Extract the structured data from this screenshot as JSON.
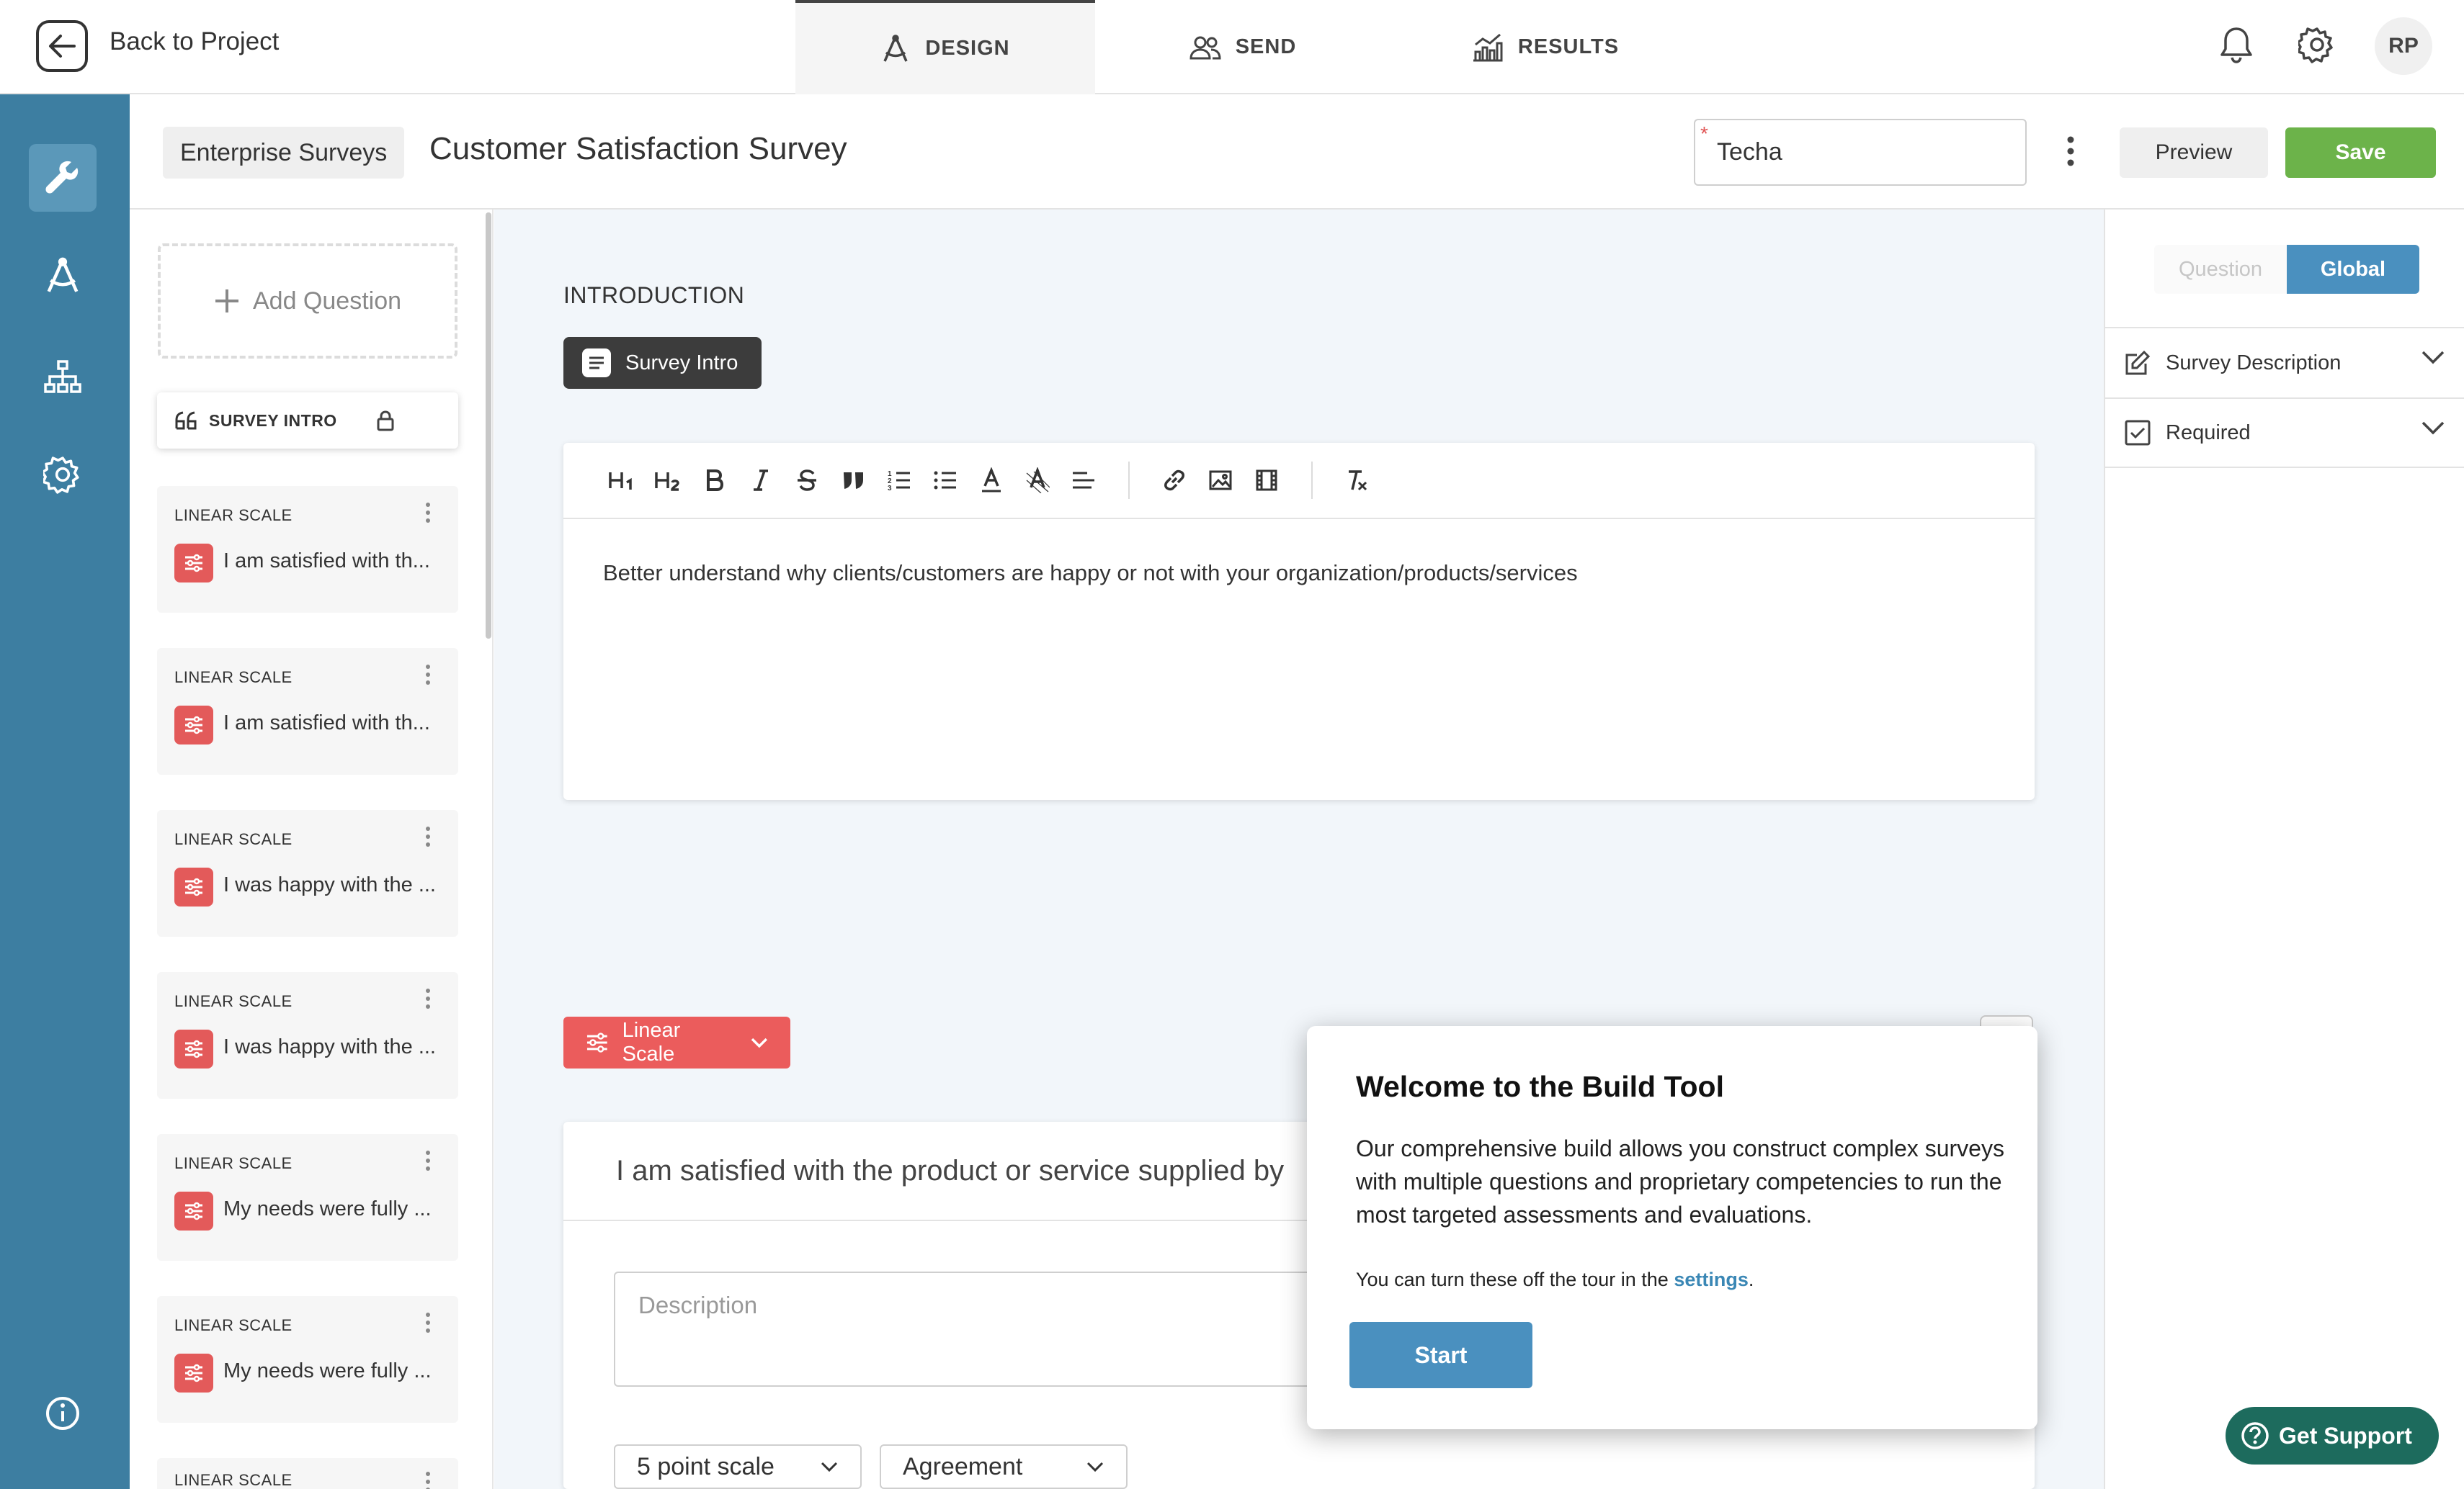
{
  "topbar": {
    "back_label": "Back to Project",
    "tabs": [
      {
        "label": "DESIGN",
        "icon": "compass-icon",
        "active": true
      },
      {
        "label": "SEND",
        "icon": "users-icon",
        "active": false
      },
      {
        "label": "RESULTS",
        "icon": "chart-icon",
        "active": false
      }
    ],
    "avatar_initials": "RP"
  },
  "header": {
    "breadcrumb": "Enterprise Surveys",
    "title": "Customer Satisfaction Survey",
    "tenant_value": "Techa",
    "required_marker": "*",
    "preview_label": "Preview",
    "save_label": "Save"
  },
  "sidebar": {
    "add_question_label": "Add Question",
    "intro_label": "SURVEY INTRO",
    "questions": [
      {
        "type": "LINEAR SCALE",
        "text": "I am satisfied with th..."
      },
      {
        "type": "LINEAR SCALE",
        "text": "I am satisfied with th..."
      },
      {
        "type": "LINEAR SCALE",
        "text": "I was happy with the ..."
      },
      {
        "type": "LINEAR SCALE",
        "text": "I was happy with the ..."
      },
      {
        "type": "LINEAR SCALE",
        "text": "My needs were fully ..."
      },
      {
        "type": "LINEAR SCALE",
        "text": "My needs were fully ..."
      },
      {
        "type": "LINEAR SCALE",
        "text": ""
      }
    ]
  },
  "main": {
    "section_heading": "INTRODUCTION",
    "intro_pill": "Survey Intro",
    "editor_text": "Better understand why clients/customers are happy or not with your organization/products/services",
    "question_type_pill": "Linear Scale",
    "question_text": "I am satisfied with the product or service supplied by",
    "description_placeholder": "Description",
    "scale_select": "5 point scale",
    "label_select": "Agreement"
  },
  "right_panel": {
    "seg_question": "Question",
    "seg_global": "Global",
    "rows": [
      {
        "label": "Survey Description",
        "icon": "edit-icon"
      },
      {
        "label": "Required",
        "icon": "checkbox-icon"
      }
    ]
  },
  "popup": {
    "title": "Welcome to the Build Tool",
    "body": "Our comprehensive build allows you construct complex surveys with multiple questions and proprietary competencies to run the most targeted assessments and evaluations.",
    "note_prefix": "You can turn these off the tour in the",
    "note_link": "settings",
    "note_suffix": ".",
    "start_label": "Start"
  },
  "support": {
    "label": "Get Support"
  },
  "colors": {
    "rail": "#3d7ea1",
    "save": "#6cb34a",
    "linear_scale": "#eb5c5c",
    "accent": "#4a90bf",
    "support": "#1d6b5d"
  }
}
